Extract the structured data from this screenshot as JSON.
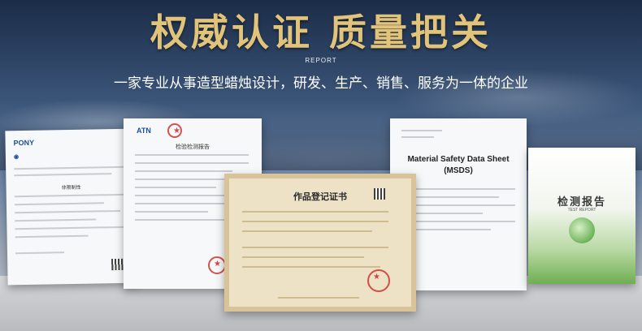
{
  "header": {
    "title": "权威认证 质量把关",
    "label": "REPORT",
    "subtitle": "一家专业从事造型蜡烛设计，研发、生产、销售、服务为一体的企业"
  },
  "documents": {
    "doc1": {
      "logo": "PONY",
      "heading": "非限制性"
    },
    "doc2": {
      "logo": "ATN",
      "heading": "检验检测报告"
    },
    "doc3": {
      "title": "作品登记证书"
    },
    "doc4": {
      "title_line1": "Material Safety Data Sheet",
      "title_line2": "(MSDS)"
    },
    "doc5": {
      "title": "检测报告",
      "subtitle": "TEST REPORT"
    }
  },
  "colors": {
    "title_gold": "#e2c37a",
    "seal_red": "#cc2828"
  }
}
